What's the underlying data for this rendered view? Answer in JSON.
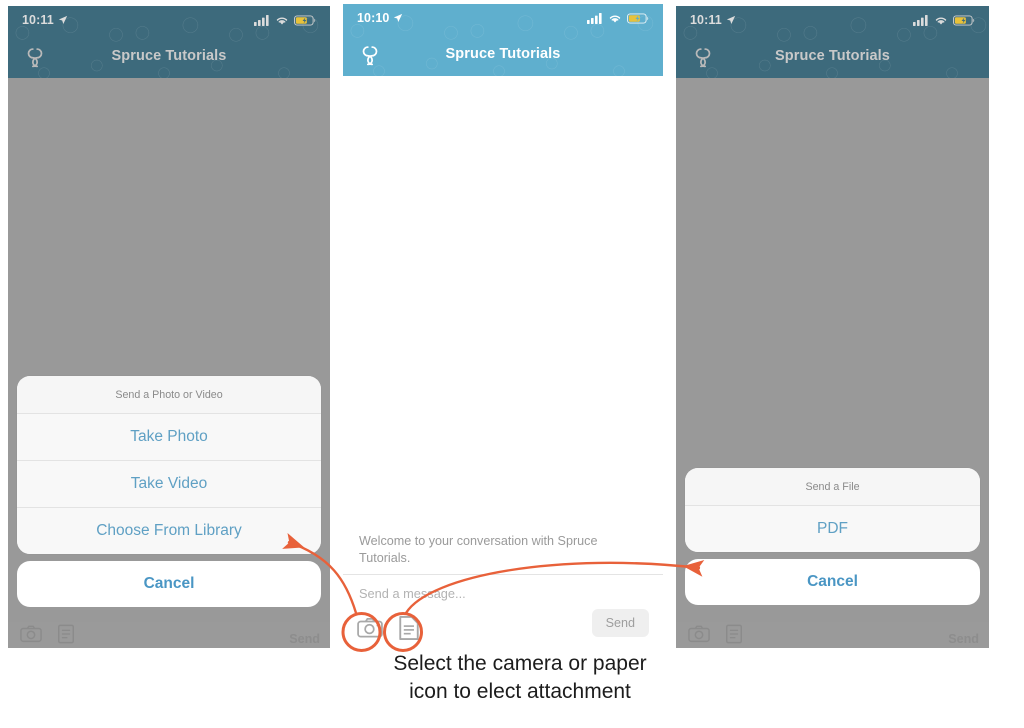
{
  "brand": {
    "name": "Spruce Tutorials",
    "header_bright": "#5FAFCE",
    "header_dim": "#3D6A7C",
    "accent_blue": "#5FA0C4",
    "annotation_orange": "#E8613A",
    "dim_overlay": "#999999"
  },
  "phones": [
    {
      "id": "phone-1",
      "status": {
        "time": "10:11",
        "location_icon": "location-arrow-icon",
        "signal_icon": "cellular-signal-icon",
        "wifi_icon": "wifi-icon",
        "battery_icon": "battery-charging-icon"
      },
      "nav": {
        "logo_icon": "spruce-logo-icon",
        "title": "Spruce Tutorials"
      },
      "dimmed": true,
      "composer": {
        "camera_icon": "camera-icon",
        "document_icon": "document-icon",
        "send_label": "Send"
      },
      "sheet": {
        "title": "Send a Photo or Video",
        "options": [
          "Take Photo",
          "Take Video",
          "Choose From Library"
        ],
        "cancel": "Cancel"
      }
    },
    {
      "id": "phone-2",
      "status": {
        "time": "10:10",
        "location_icon": "location-arrow-icon",
        "signal_icon": "cellular-signal-icon",
        "wifi_icon": "wifi-icon",
        "battery_icon": "battery-charging-icon"
      },
      "nav": {
        "logo_icon": "spruce-logo-icon",
        "title": "Spruce Tutorials"
      },
      "dimmed": false,
      "conversation": {
        "welcome_text": "Welcome to your conversation with Spruce Tutorials."
      },
      "composer": {
        "placeholder": "Send a message...",
        "camera_icon": "camera-icon",
        "document_icon": "document-icon",
        "send_label": "Send"
      }
    },
    {
      "id": "phone-3",
      "status": {
        "time": "10:11",
        "location_icon": "location-arrow-icon",
        "signal_icon": "cellular-signal-icon",
        "wifi_icon": "wifi-icon",
        "battery_icon": "battery-charging-icon"
      },
      "nav": {
        "logo_icon": "spruce-logo-icon",
        "title": "Spruce Tutorials"
      },
      "dimmed": true,
      "composer": {
        "camera_icon": "camera-icon",
        "document_icon": "document-icon",
        "send_label": "Send"
      },
      "sheet": {
        "title": "Send a File",
        "options": [
          "PDF"
        ],
        "cancel": "Cancel"
      }
    }
  ],
  "annotations": {
    "caption_line1": "Select the camera or paper",
    "caption_line2": "icon to elect attachment",
    "highlight_camera": "camera-icon-highlight-circle",
    "highlight_document": "document-icon-highlight-circle",
    "arrow_left": "arrow-to-photo-sheet",
    "arrow_right": "arrow-to-file-sheet"
  }
}
